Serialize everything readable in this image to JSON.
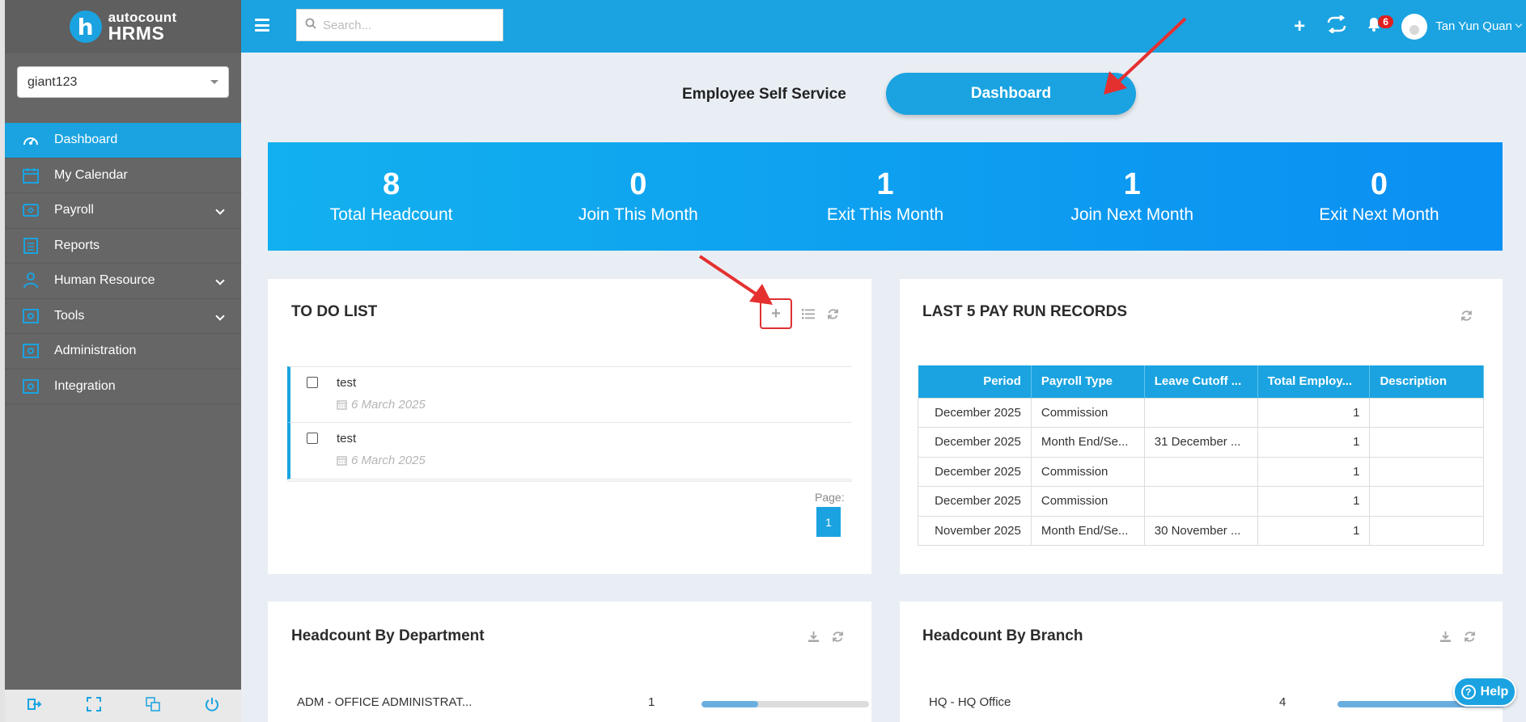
{
  "app": {
    "brand_top": "autocount",
    "brand_bottom": "HRMS",
    "brand_letter": "h",
    "company": "giant123"
  },
  "sidebar": {
    "items": [
      {
        "label": "Dashboard",
        "icon": "dashboard-gauge-icon",
        "active": true
      },
      {
        "label": "My Calendar",
        "icon": "calendar-icon"
      },
      {
        "label": "Payroll",
        "icon": "payroll-icon",
        "expandable": true
      },
      {
        "label": "Reports",
        "icon": "reports-icon"
      },
      {
        "label": "Human Resource",
        "icon": "human-resource-icon",
        "expandable": true
      },
      {
        "label": "Tools",
        "icon": "tools-icon",
        "expandable": true
      },
      {
        "label": "Administration",
        "icon": "administration-icon"
      },
      {
        "label": "Integration",
        "icon": "integration-icon"
      }
    ],
    "footer_icons": [
      "sign-out-icon",
      "fullscreen-icon",
      "language-icon",
      "power-icon"
    ]
  },
  "topbar": {
    "search_placeholder": "Search...",
    "notification_count": "6",
    "user_name": "Tan Yun Quan"
  },
  "toggle": {
    "ess_label": "Employee Self Service",
    "dashboard_label": "Dashboard"
  },
  "stats": [
    {
      "value": "8",
      "label": "Total Headcount"
    },
    {
      "value": "0",
      "label": "Join This Month"
    },
    {
      "value": "1",
      "label": "Exit This Month"
    },
    {
      "value": "1",
      "label": "Join Next Month"
    },
    {
      "value": "0",
      "label": "Exit Next Month"
    }
  ],
  "todo": {
    "title": "TO DO LIST",
    "items": [
      {
        "text": "test",
        "date": "6 March 2025"
      },
      {
        "text": "test",
        "date": "6 March 2025"
      }
    ],
    "page_label": "Page:",
    "page": "1"
  },
  "payruns": {
    "title": "LAST 5 PAY RUN RECORDS",
    "columns": [
      "Period",
      "Payroll Type",
      "Leave Cutoff ...",
      "Total Employ...",
      "Description"
    ],
    "rows": [
      [
        "December 2025",
        "Commission",
        "",
        "1",
        ""
      ],
      [
        "December 2025",
        "Month End/Se...",
        "31 December ...",
        "1",
        ""
      ],
      [
        "December 2025",
        "Commission",
        "",
        "1",
        ""
      ],
      [
        "December 2025",
        "Commission",
        "",
        "1",
        ""
      ],
      [
        "November 2025",
        "Month End/Se...",
        "30 November ...",
        "1",
        ""
      ]
    ]
  },
  "dept": {
    "title": "Headcount By Department",
    "rows": [
      {
        "name": "ADM - OFFICE ADMINISTRAT...",
        "count": "1",
        "fraction": 0.34
      }
    ]
  },
  "branch": {
    "title": "Headcount By Branch",
    "rows": [
      {
        "name": "HQ - HQ Office",
        "count": "4",
        "fraction": 1.0
      }
    ]
  },
  "help": {
    "label": "Help"
  },
  "colors": {
    "accent": "#1aa3e0",
    "sidebar": "#666666",
    "badge": "#e02020",
    "annotation": "#e53030"
  }
}
